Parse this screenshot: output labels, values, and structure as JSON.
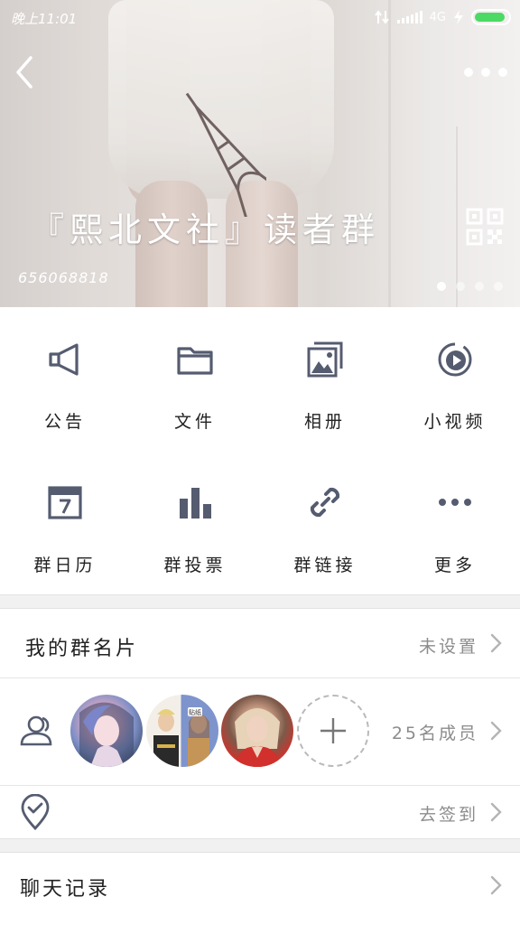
{
  "status_bar": {
    "time": "晚上11:01",
    "network": "4G"
  },
  "header": {
    "group_name": "『熙北文社』读者群",
    "group_id": "656068818",
    "carousel_pages": 4,
    "carousel_active": 1
  },
  "features": [
    {
      "label": "公告",
      "icon": "megaphone-icon"
    },
    {
      "label": "文件",
      "icon": "folder-icon"
    },
    {
      "label": "相册",
      "icon": "photo-album-icon"
    },
    {
      "label": "小视频",
      "icon": "video-icon"
    },
    {
      "label": "群日历",
      "icon": "calendar-icon"
    },
    {
      "label": "群投票",
      "icon": "bar-chart-icon"
    },
    {
      "label": "群链接",
      "icon": "link-icon"
    },
    {
      "label": "更多",
      "icon": "more-dots-icon"
    }
  ],
  "group_card": {
    "title": "我的群名片",
    "value": "未设置"
  },
  "members": {
    "count_text": "25名成员",
    "avatar_badge": "贴纸"
  },
  "checkin": {
    "value": "去签到"
  },
  "chat_history": {
    "title": "聊天记录"
  },
  "colors": {
    "icon_gray": "#555c70",
    "battery_green": "#4cd964",
    "secondary_text": "#8c8c8c",
    "separator_bg": "#f1f1f1"
  }
}
